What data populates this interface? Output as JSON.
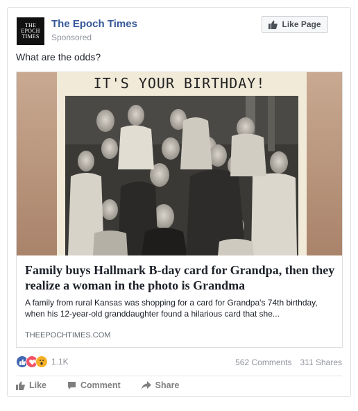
{
  "header": {
    "logo_lines": [
      "THE",
      "EPOCH",
      "TIMES"
    ],
    "page_name": "The Epoch Times",
    "sponsored": "Sponsored",
    "like_page_label": "Like Page"
  },
  "post": {
    "text": "What are the odds?"
  },
  "link": {
    "image_caption": "IT'S YOUR BIRTHDAY!",
    "headline": "Family buys Hallmark B-day card for Grandpa, then they realize a woman in the photo is Grandma",
    "description": "A family from rural Kansas was shopping for a card for Grandpa's 74th birthday, when his 12-year-old granddaughter found a hilarious card that she...",
    "domain": "THEEPOCHTIMES.COM"
  },
  "engagement": {
    "reaction_count": "1.1K",
    "comments": "562 Comments",
    "shares": "311 Shares"
  },
  "actions": {
    "like": "Like",
    "comment": "Comment",
    "share": "Share"
  },
  "colors": {
    "brand_blue": "#365899",
    "like_blue": "#4267b2",
    "love_red": "#f25268",
    "wow_yellow": "#f7b125"
  }
}
